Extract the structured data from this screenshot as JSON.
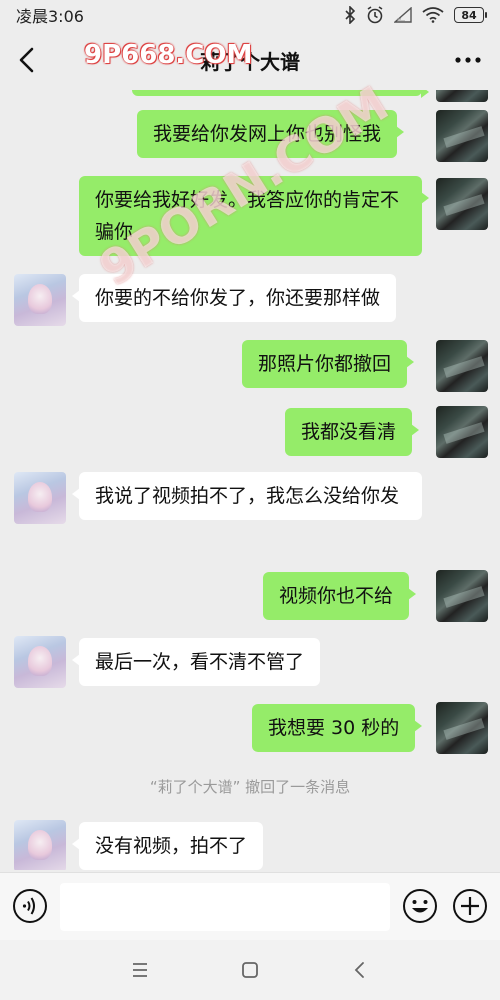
{
  "status_bar": {
    "time": "凌晨3:06",
    "battery": "84"
  },
  "header": {
    "title": "莉了个大谱"
  },
  "watermark": {
    "text": "9P668.COM",
    "diagonal_text": "9PORN.COM"
  },
  "messages": [
    {
      "side": "me",
      "text": "我要给你发网上你也别怪我"
    },
    {
      "side": "me",
      "text": "你要给我好好发。我答应你的肯定不骗你"
    },
    {
      "side": "other",
      "text": "你要的不给你发了，你还要那样做"
    },
    {
      "side": "me",
      "text": "那照片你都撤回"
    },
    {
      "side": "me",
      "text": "我都没看清"
    },
    {
      "side": "other",
      "text": "我说了视频拍不了，我怎么没给你发"
    },
    {
      "side": "me",
      "text": "视频你也不给"
    },
    {
      "side": "other",
      "text": "最后一次，看不清不管了"
    },
    {
      "side": "me",
      "text": "我想要 30 秒的"
    },
    {
      "side": "other",
      "text": "没有视频，拍不了"
    }
  ],
  "system_message": "“莉了个大谱” 撤回了一条消息",
  "input": {
    "placeholder": ""
  },
  "colors": {
    "me_bubble": "#95ec69",
    "other_bubble": "#ffffff",
    "background": "#ededed"
  },
  "icons": [
    "back-icon",
    "more-icon",
    "voice-icon",
    "emoji-icon",
    "plus-icon",
    "menu-icon",
    "home-icon",
    "nav-back-icon"
  ]
}
